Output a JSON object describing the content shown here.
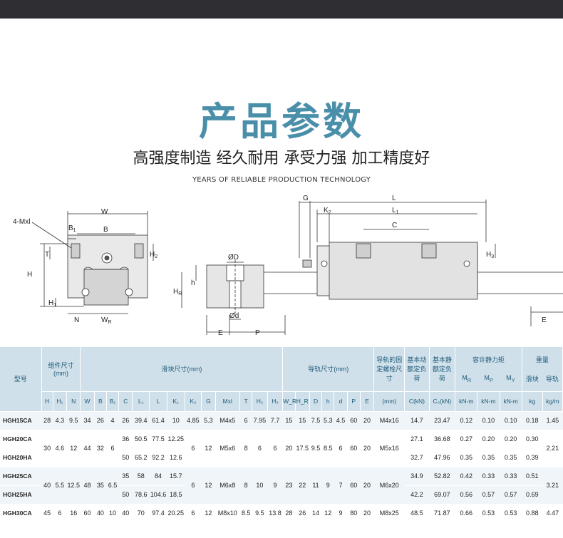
{
  "header": {
    "title": "产品参数",
    "subtitle": "高强度制造 经久耐用 承受力强 加工精度好",
    "tagline": "YEARS OF RELIABLE PRODUCTION TECHNOLOGY"
  },
  "drawing_labels": {
    "mxl": "4-Mxl",
    "w": "W",
    "b1": "B",
    "b1_sub": "1",
    "b": "B",
    "t": "T",
    "h2": "H",
    "h2_sub": "2",
    "h": "H",
    "h1": "H",
    "h1_sub": "1",
    "n": "N",
    "wr": "W",
    "wr_sub": "R",
    "g": "G",
    "l": "L",
    "k2": "K",
    "k2_sub": "2",
    "l1": "L",
    "l1_sub": "1",
    "c": "C",
    "h3": "H",
    "h3_sub": "3",
    "e_right": "E",
    "od": "ØD",
    "hr": "H",
    "hr_sub": "R",
    "hh": "h",
    "odd": "Ød",
    "e_left": "E",
    "p": "P"
  },
  "table": {
    "col_model": "型号",
    "group_assembly": "组件尺寸(mm)",
    "group_block": "滑块尺寸(mm)",
    "group_rail": "导轨尺寸(mm)",
    "group_bolt": "导轨的固定螺栓尺寸",
    "group_dynamic": "基本动额定负荷",
    "group_static": "基本静额定负荷",
    "group_moment": "容许静力矩",
    "group_weight": "重量",
    "sub_headers": [
      "H",
      "H₁",
      "N",
      "W",
      "B",
      "B₁",
      "C",
      "L₁",
      "L",
      "K₁",
      "K₂",
      "G",
      "Mxl",
      "T",
      "H₂",
      "H₃",
      "W_R",
      "H_R",
      "D",
      "h",
      "d",
      "P",
      "E",
      "(mm)",
      "C(kN)",
      "C₀(kN)",
      "kN-m",
      "kN-m",
      "kN-m",
      "kg",
      "kg/m"
    ],
    "moment_labels": [
      "M_R",
      "M_P",
      "M_Y"
    ],
    "weight_labels": [
      "滑块",
      "导轨"
    ],
    "rows": [
      {
        "model": "HGH15CA",
        "H": "28",
        "H1": "4.3",
        "N": "9.5",
        "W": "34",
        "B": "26",
        "B1": "4",
        "C": "26",
        "L1": "39.4",
        "L": "61.4",
        "K1": "10",
        "K2": "4.85",
        "G": "5.3",
        "Mxl": "M4x5",
        "T": "6",
        "H2": "7.95",
        "H3": "7.7",
        "WR": "15",
        "HR": "15",
        "D": "7.5",
        "h": "5.3",
        "d": "4.5",
        "P": "60",
        "E": "20",
        "bolt": "M4x16",
        "Cdyn": "14.7",
        "Cstat": "23.47",
        "MR": "0.12",
        "MP": "0.10",
        "MY": "0.10",
        "kg": "0.18",
        "kgm": "1.45"
      },
      {
        "model": "HGH20CA",
        "C": "36",
        "L1": "50.5",
        "L": "77.5",
        "K1": "12.25",
        "Cdyn": "27.1",
        "Cstat": "36.68",
        "MR": "0.27",
        "MP": "0.20",
        "MY": "0.20",
        "kg": "0.30"
      },
      {
        "model": "HGH20HA",
        "C": "50",
        "L1": "65.2",
        "L": "92.2",
        "K1": "12.6",
        "Cdyn": "32.7",
        "Cstat": "47.96",
        "MR": "0.35",
        "MP": "0.35",
        "MY": "0.35",
        "kg": "0.39"
      },
      {
        "model": "HGH25CA",
        "C": "35",
        "L1": "58",
        "L": "84",
        "K1": "15.7",
        "Cdyn": "34.9",
        "Cstat": "52.82",
        "MR": "0.42",
        "MP": "0.33",
        "MY": "0.33",
        "kg": "0.51"
      },
      {
        "model": "HGH25HA",
        "C": "50",
        "L1": "78.6",
        "L": "104.6",
        "K1": "18.5",
        "Cdyn": "42.2",
        "Cstat": "69.07",
        "MR": "0.56",
        "MP": "0.57",
        "MY": "0.57",
        "kg": "0.69"
      },
      {
        "model": "HGH30CA",
        "C": "40",
        "L1": "70",
        "L": "97.4",
        "K1": "20.25",
        "Cdyn": "48.5",
        "Cstat": "71.87",
        "MR": "0.66",
        "MP": "0.53",
        "MY": "0.53",
        "kg": "0.88"
      }
    ],
    "shared_20": {
      "H": "30",
      "H1": "4.6",
      "N": "12",
      "W": "44",
      "B": "32",
      "B1": "6",
      "K2": "6",
      "G": "12",
      "Mxl": "M5x6",
      "T": "8",
      "H2": "6",
      "H3": "6",
      "WR": "20",
      "HR": "17.5",
      "D": "9.5",
      "h": "8.5",
      "d": "6",
      "P": "60",
      "E": "20",
      "bolt": "M5x16",
      "kgm": "2.21"
    },
    "shared_25": {
      "H": "40",
      "H1": "5.5",
      "N": "12.5",
      "W": "48",
      "B": "35",
      "B1": "6.5",
      "K2": "6",
      "G": "12",
      "Mxl": "M6x8",
      "T": "8",
      "H2": "10",
      "H3": "9",
      "WR": "23",
      "HR": "22",
      "D": "11",
      "h": "9",
      "d": "7",
      "P": "60",
      "E": "20",
      "bolt": "M6x20",
      "kgm": "3.21"
    },
    "shared_30": {
      "H": "45",
      "H1": "6",
      "N": "16",
      "W": "60",
      "B": "40",
      "B1": "10",
      "K2": "6",
      "G": "12",
      "Mxl": "M8x10",
      "T": "8.5",
      "H2": "9.5",
      "H3": "13.8",
      "WR": "28",
      "HR": "26",
      "D": "14",
      "h": "12",
      "d": "9",
      "P": "80",
      "E": "20",
      "bolt": "M8x25",
      "kgm": "4.47"
    }
  }
}
